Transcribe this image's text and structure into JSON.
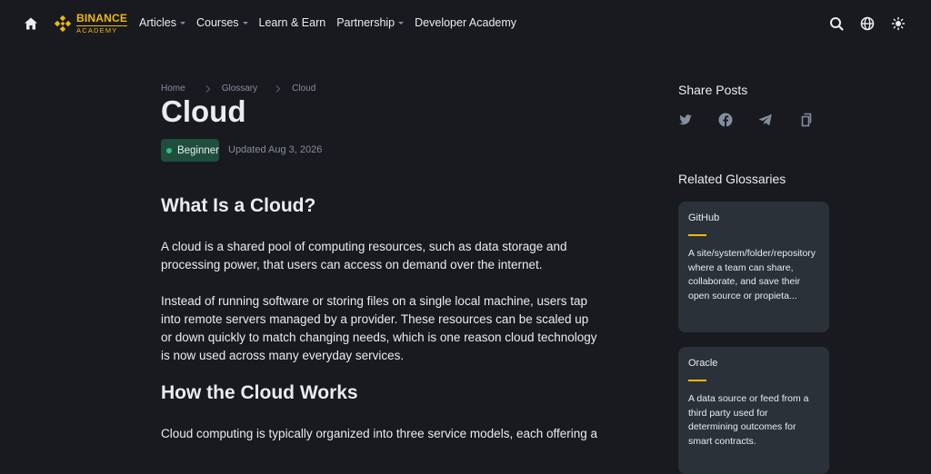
{
  "nav": {
    "logo_line1": "BINANCE",
    "logo_line2": "ACADEMY",
    "menu": [
      {
        "label": "Articles",
        "caret": true
      },
      {
        "label": "Courses",
        "caret": true
      },
      {
        "label": "Learn & Earn",
        "caret": false
      },
      {
        "label": "Partnership",
        "caret": true
      },
      {
        "label": "Developer Academy",
        "caret": false
      }
    ],
    "right_icons": [
      "search-icon",
      "globe-icon",
      "theme-toggle-icon"
    ]
  },
  "breadcrumb": [
    "Home",
    "Glossary",
    "Cloud"
  ],
  "title": "Cloud",
  "badge": "Beginner",
  "updated": "Updated Aug 3, 2026",
  "sections": [
    {
      "heading": "What Is a Cloud?"
    },
    {
      "heading": "How the Cloud Works"
    }
  ],
  "paragraphs": [
    "A cloud is a shared pool of computing resources, such as data storage and processing power, that users can access on demand over the internet.",
    "Instead of running software or storing files on a single local machine, users tap into remote servers managed by a provider. These resources can be scaled up or down quickly to match changing needs, which is one reason cloud technology is now used across many everyday services.",
    "Cloud computing is typically organized into three service models, each offering a"
  ],
  "share": {
    "title": "Share Posts",
    "icons": [
      "twitter-icon",
      "facebook-icon",
      "telegram-icon",
      "copy-link-icon"
    ]
  },
  "related": {
    "title": "Related Glossaries",
    "cards": [
      {
        "title": "GitHub",
        "desc": "A site/system/folder/repository where a team can share, collaborate, and save their open source or propieta..."
      },
      {
        "title": "Oracle",
        "desc": "A data source or feed from a third party used for determining outcomes for smart contracts."
      }
    ]
  },
  "colors": {
    "background": "#181a20",
    "brand": "#f0b90b",
    "card": "#2b3139",
    "badge_bg": "#1f4e3d",
    "badge_dot": "#2ebd85",
    "muted": "#848e9c"
  }
}
